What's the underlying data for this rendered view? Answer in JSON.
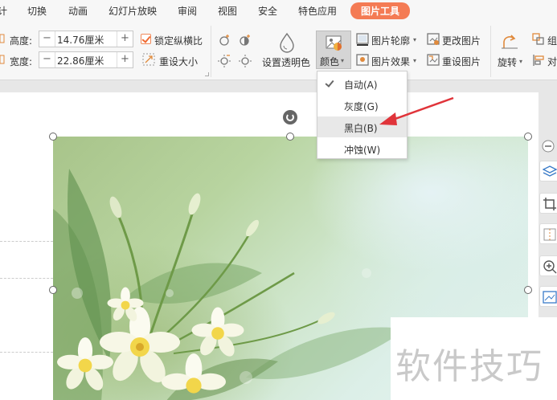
{
  "menu": {
    "tabs": [
      {
        "label": "计"
      },
      {
        "label": "切换"
      },
      {
        "label": "动画"
      },
      {
        "label": "幻灯片放映"
      },
      {
        "label": "审阅"
      },
      {
        "label": "视图"
      },
      {
        "label": "安全"
      },
      {
        "label": "特色应用"
      }
    ],
    "active_tab": "图片工具",
    "active_color": "#f47b54"
  },
  "ribbon": {
    "height_label": "高度:",
    "height_value": "14.76厘米",
    "width_label": "宽度:",
    "width_value": "22.86厘米",
    "lock_ratio_label": "锁定纵横比",
    "lock_ratio_checked": true,
    "resize_label": "重设大小",
    "transparent_label": "设置透明色",
    "color_label": "颜色",
    "outline_label": "图片轮廓",
    "effects_label": "图片效果",
    "change_picture_label": "更改图片",
    "reset_picture_label": "重设图片",
    "rotate_label": "旋转",
    "group_label": "组",
    "align_label": "对"
  },
  "color_menu": {
    "items": [
      {
        "label": "自动(A)",
        "checked": true
      },
      {
        "label": "灰度(G)",
        "checked": false
      },
      {
        "label": "黑白(B)",
        "checked": false,
        "highlighted": true
      },
      {
        "label": "冲蚀(W)",
        "checked": false
      }
    ]
  },
  "icons": [
    "minus-icon",
    "plus-icon",
    "layers-icon",
    "crop-icon",
    "split-icon",
    "zoom-in-icon",
    "image-frame-icon",
    "rotate-icon",
    "water-drop-icon",
    "arrow-pointer"
  ],
  "watermark": "软件技巧",
  "annotation_arrow_color": "#e0343a"
}
